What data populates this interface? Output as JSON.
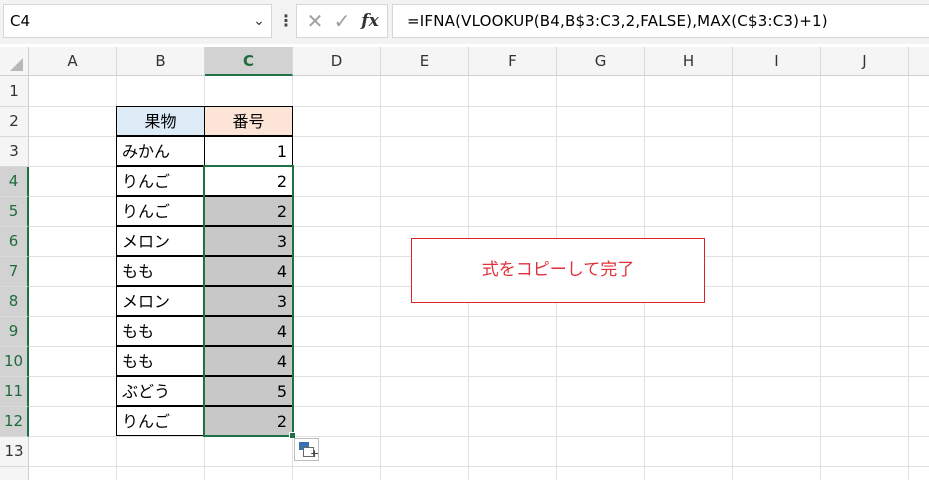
{
  "formula_bar": {
    "name_box": "C4",
    "formula": "=IFNA(VLOOKUP(B4,B$3:C3,2,FALSE),MAX(C$3:C3)+1)",
    "cancel_icon": "✕",
    "enter_icon": "✓",
    "fx_label": "fx"
  },
  "columns": [
    "A",
    "B",
    "C",
    "D",
    "E",
    "F",
    "G",
    "H",
    "I",
    "J"
  ],
  "rows": [
    "1",
    "2",
    "3",
    "4",
    "5",
    "6",
    "7",
    "8",
    "9",
    "10",
    "11",
    "12",
    "13"
  ],
  "table": {
    "header_b": "果物",
    "header_c": "番号",
    "rows": [
      {
        "fruit": "みかん",
        "num": "1"
      },
      {
        "fruit": "りんご",
        "num": "2"
      },
      {
        "fruit": "りんご",
        "num": "2"
      },
      {
        "fruit": "メロン",
        "num": "3"
      },
      {
        "fruit": "もも",
        "num": "4"
      },
      {
        "fruit": "メロン",
        "num": "3"
      },
      {
        "fruit": "もも",
        "num": "4"
      },
      {
        "fruit": "もも",
        "num": "4"
      },
      {
        "fruit": "ぶどう",
        "num": "5"
      },
      {
        "fruit": "りんご",
        "num": "2"
      }
    ]
  },
  "note": "式をコピーして完了",
  "colors": {
    "header_b_fill": "#ddebf7",
    "header_c_fill": "#fce4d6",
    "copied_fill": "#c8c8c8",
    "selection": "#1e7145",
    "note_text": "#e0303a"
  },
  "icons": {
    "name_box_dropdown": "chevron-down-icon",
    "paste_options": "paste-options-icon"
  }
}
